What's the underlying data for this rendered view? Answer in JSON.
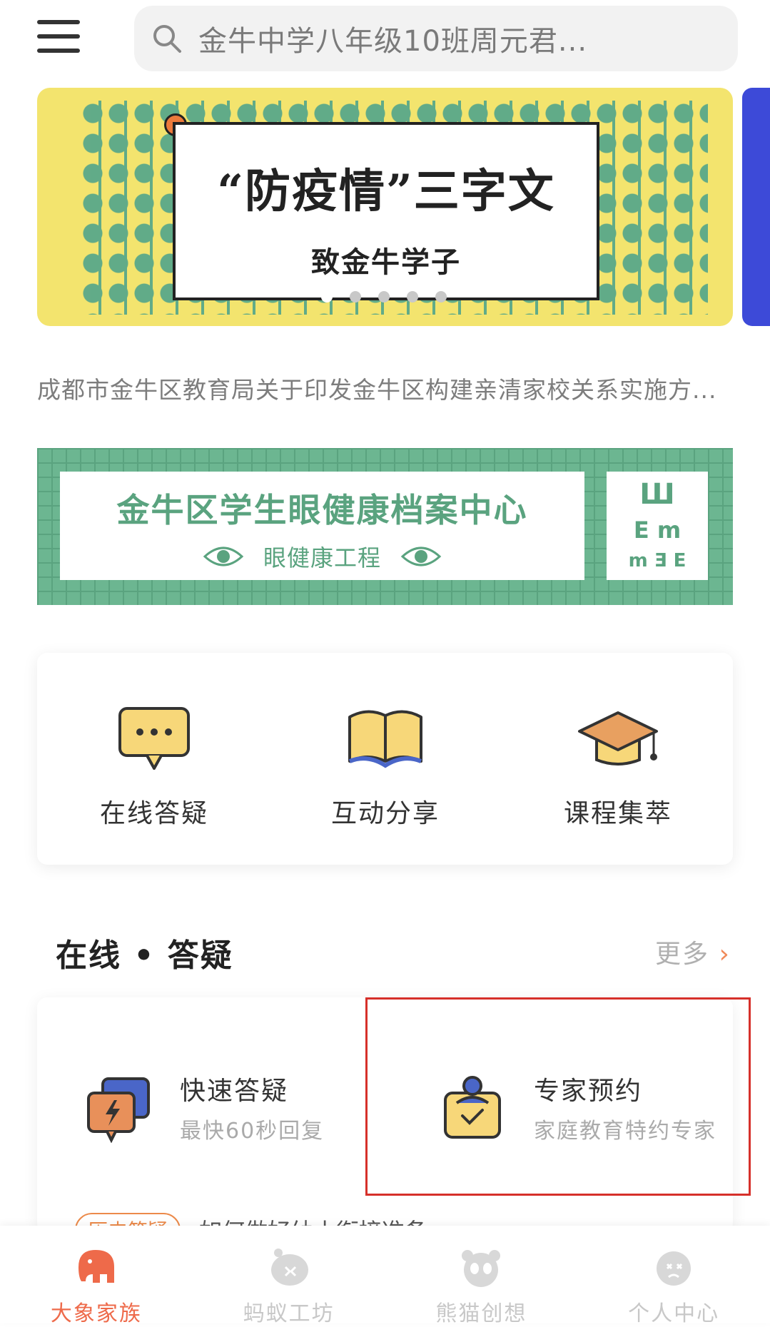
{
  "header": {
    "search_placeholder": "金牛中学八年级10班周元君..."
  },
  "banner": {
    "title": "“防疫情”三字文",
    "subtitle": "致金牛学子",
    "dots_count": 5,
    "active_dot": 0
  },
  "notice": {
    "text": "成都市金牛区教育局关于印发金牛区构建亲清家校关系实施方..."
  },
  "eye_banner": {
    "title": "金牛区学生眼健康档案中心",
    "subtitle": "眼健康工程",
    "chart_rows": [
      "Ш",
      "E m",
      "m Ǝ E"
    ]
  },
  "quick_entries": [
    {
      "label": "在线答疑",
      "icon": "chat-bubble-icon"
    },
    {
      "label": "互动分享",
      "icon": "open-book-icon"
    },
    {
      "label": "课程集萃",
      "icon": "graduation-cap-icon"
    }
  ],
  "section": {
    "title": "在线 • 答疑",
    "more": "更多"
  },
  "services": [
    {
      "title": "快速答疑",
      "desc": "最快60秒回复",
      "icon": "lightning-chat-icon"
    },
    {
      "title": "专家预约",
      "desc": "家庭教育特约专家",
      "icon": "expert-booking-icon"
    }
  ],
  "history": {
    "tag": "历史答疑",
    "text": "如何做好幼小衔接准备"
  },
  "tabs": [
    {
      "label": "大象家族",
      "icon": "elephant-icon",
      "active": true
    },
    {
      "label": "蚂蚁工坊",
      "icon": "ant-icon",
      "active": false
    },
    {
      "label": "熊猫创想",
      "icon": "panda-icon",
      "active": false
    },
    {
      "label": "个人中心",
      "icon": "user-face-icon",
      "active": false
    }
  ],
  "colors": {
    "accent": "#ee6a4a",
    "green": "#5aa37f",
    "yellow": "#f3e46e",
    "highlight_border": "#d6302a"
  }
}
